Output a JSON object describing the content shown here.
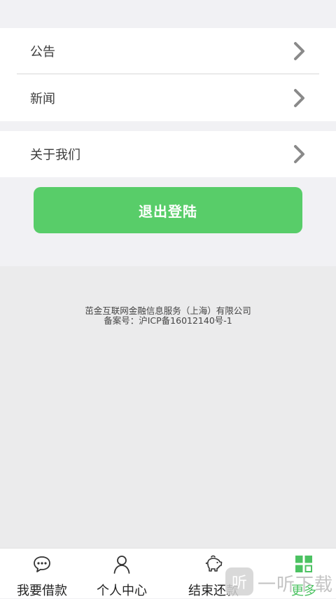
{
  "menu": {
    "group1": [
      {
        "label": "公告"
      },
      {
        "label": "新闻"
      }
    ],
    "group2": [
      {
        "label": "关于我们"
      }
    ]
  },
  "logout_label": "退出登陆",
  "footer": {
    "company": "茁金互联网金融信息服务（上海）有限公司",
    "icp": "备案号：沪ICP备16012140号-1"
  },
  "tabs": [
    {
      "label": "我要借款",
      "icon": "chat-bubble-icon",
      "active": false
    },
    {
      "label": "个人中心",
      "icon": "person-icon",
      "active": false
    },
    {
      "label": "结束还款",
      "icon": "piggy-bank-icon",
      "active": false
    },
    {
      "label": "更多",
      "icon": "grid-icon",
      "active": true
    }
  ],
  "watermark": {
    "text": "一听下载"
  },
  "colors": {
    "accent": "#58cd69",
    "tab_active": "#4cc262",
    "background": "#f1f1f4"
  }
}
